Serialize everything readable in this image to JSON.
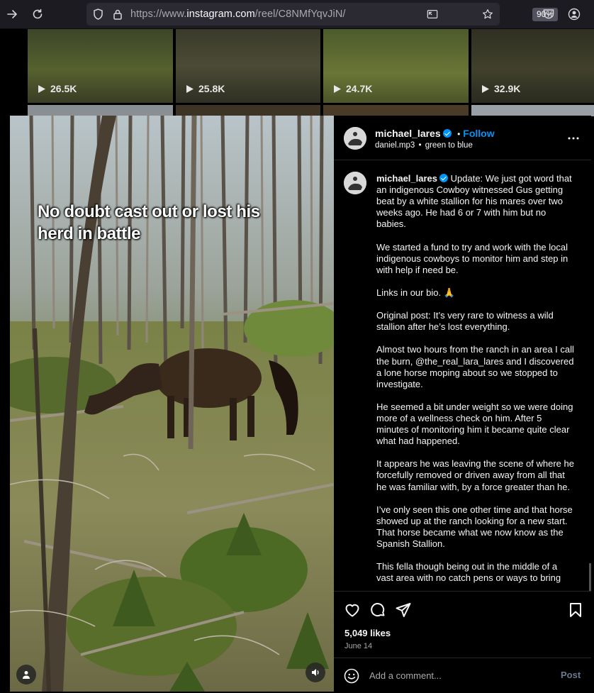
{
  "browser": {
    "url_prefix": "https://www.",
    "url_domain": "instagram.com",
    "url_path": "/reel/C8NMfYqvJiN/",
    "zoom": "90%"
  },
  "background": {
    "thumb_counts": [
      "26.5K",
      "25.8K",
      "24.7K",
      "32.9K"
    ]
  },
  "media": {
    "overlay_text_line1": "No doubt cast out or lost his",
    "overlay_text_line2": "herd in battle"
  },
  "post": {
    "username": "michael_lares",
    "separator": "•",
    "follow_label": "Follow",
    "audio": "daniel.mp3",
    "audio_sep": "•",
    "audio_title": "green to blue",
    "caption_username": "michael_lares",
    "caption_first": "Update: We just got word that an indigenous Cowboy witnessed Gus getting beat by a white stallion for his mares over two weeks ago. He had 6 or 7 with him but no babies.",
    "caption_paragraphs": [
      "We started a fund to try and work with the local indigenous cowboys to monitor him and step in with help if need be.",
      "Links in our bio. 🙏",
      "Original post: It’s very rare to witness a wild stallion after he’s lost everything.",
      "Almost two hours from the ranch in an area I call the burn, @the_real_lara_lares and I discovered a lone horse moping about so we stopped to investigate.",
      "He seemed a bit under weight so we were doing more of a wellness check on him. After 5 minutes of monitoring him it became quite clear what had happened.",
      "It appears he was leaving the scene of where he forcefully removed or driven away from all that he was familiar with, by a force greater than he.",
      "I’ve only seen this one other time and that horse showed up at the ranch looking for a new start. That horse became what we now know as the Spanish Stallion.",
      "This fella though being out in the middle of a vast area with no catch pens or ways to bring"
    ],
    "likes": "5,049 likes",
    "date": "June 14",
    "comment_placeholder": "Add a comment...",
    "post_label": "Post"
  },
  "colors": {
    "accent": "#0095f6",
    "panel_bg": "#000000",
    "border": "#262626"
  }
}
